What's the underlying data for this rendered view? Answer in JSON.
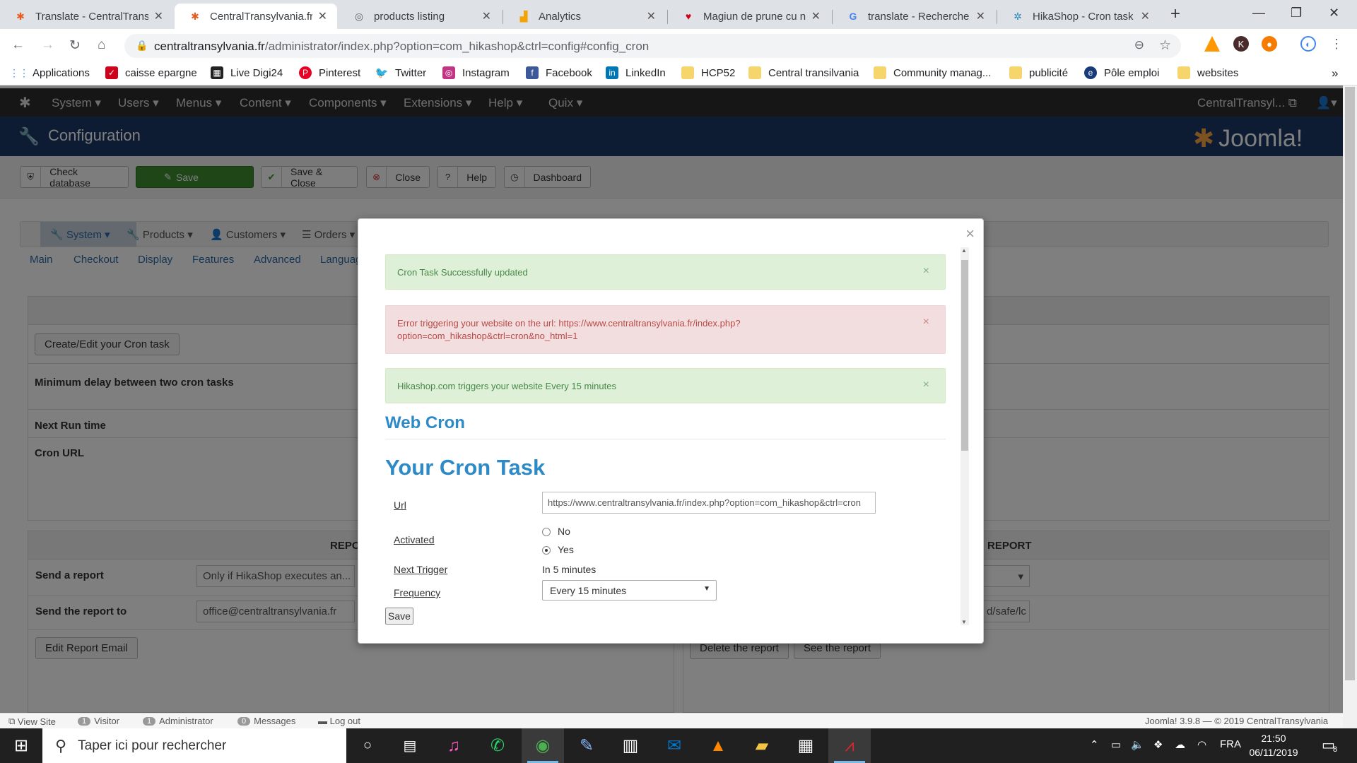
{
  "browser": {
    "tabs": [
      {
        "title": "Translate - CentralTrans",
        "icon": "joomla-favicon",
        "active": false
      },
      {
        "title": "CentralTransylvania.fr -",
        "icon": "joomla-favicon",
        "active": true
      },
      {
        "title": "products listing",
        "icon": "globe-icon",
        "active": false
      },
      {
        "title": "Analytics",
        "icon": "analytics-icon",
        "active": false
      },
      {
        "title": "Magiun de prune cu nu",
        "icon": "heart-icon",
        "active": false
      },
      {
        "title": "translate - Recherche G",
        "icon": "google-icon",
        "active": false
      },
      {
        "title": "HikaShop - Cron task",
        "icon": "hikashop-icon",
        "active": false
      }
    ],
    "new_tab": "+",
    "url_host": "centraltransylvania.fr",
    "url_path": "/administrator/index.php?option=com_hikashop&ctrl=config#config_cron",
    "bookmarks": [
      {
        "label": "Applications"
      },
      {
        "label": "caisse epargne"
      },
      {
        "label": "Live Digi24"
      },
      {
        "label": "Pinterest"
      },
      {
        "label": "Twitter"
      },
      {
        "label": "Instagram"
      },
      {
        "label": "Facebook"
      },
      {
        "label": "LinkedIn"
      },
      {
        "label": "HCP52"
      },
      {
        "label": "Central transilvania"
      },
      {
        "label": "Community manag..."
      },
      {
        "label": "publicité"
      },
      {
        "label": "Pôle emploi"
      },
      {
        "label": "websites"
      }
    ],
    "more": "»",
    "ext_k": "K"
  },
  "joomla": {
    "menu": [
      "System",
      "Users",
      "Menus",
      "Content",
      "Components",
      "Extensions",
      "Help",
      "Quix"
    ],
    "site_name": "CentralTransyl...",
    "page_title": "Configuration",
    "brand": "Joomla!",
    "toolbar": {
      "check_database": "Check database",
      "save": "Save",
      "save_close": "Save & Close",
      "close": "Close",
      "help": "Help",
      "dashboard": "Dashboard"
    },
    "hika_nav": [
      "System",
      "Products",
      "Customers",
      "Orders"
    ],
    "sub_tabs": [
      "Main",
      "Checkout",
      "Display",
      "Features",
      "Advanced",
      "Languag"
    ],
    "create_cron": "Create/Edit your Cron task",
    "min_delay": "Minimum delay between two cron tasks",
    "next_run": "Next Run time",
    "cron_url": "Cron URL",
    "report_left": "REPO",
    "report_right": "REPORT",
    "send_report": "Send a report",
    "send_report_value": "Only if HikaShop executes an...",
    "send_to": "Send the report to",
    "send_to_value": "office@centraltransylvania.fr",
    "right_field_value": "d/safe/lc",
    "edit_report": "Edit Report Email",
    "delete_report": "Delete the report",
    "see_report": "See the report",
    "status": {
      "view_site": "View Site",
      "visitor_count": "1",
      "visitor": "Visitor",
      "admin_count": "1",
      "admin": "Administrator",
      "messages_count": "0",
      "messages": "Messages",
      "logout": "Log out",
      "footer": "Joomla! 3.9.8 — © 2019 CentralTransylvania"
    }
  },
  "modal": {
    "alert_success": "Cron Task Successfully updated",
    "alert_error": "Error triggering your website on the url: https://www.centraltransylvania.fr/index.php?option=com_hikashop&ctrl=cron&no_html=1",
    "alert_info": "Hikashop.com triggers your website Every 15 minutes",
    "heading_web_cron": "Web Cron",
    "heading_task": "Your Cron Task",
    "url_label": "Url",
    "url_value": "https://www.centraltransylvania.fr/index.php?option=com_hikashop&ctrl=cron",
    "activated_label": "Activated",
    "opt_no": "No",
    "opt_yes": "Yes",
    "next_trigger_label": "Next Trigger",
    "next_trigger_value": "In 5 minutes",
    "frequency_label": "Frequency",
    "frequency_value": "Every 15 minutes",
    "save": "Save",
    "close": "×"
  },
  "taskbar": {
    "search_placeholder": "Taper ici pour rechercher",
    "lang": "FRA",
    "time": "21:50",
    "date": "06/11/2019",
    "notif_count": "8"
  },
  "colors": {
    "joomla_nav": "#2c2c2c",
    "joomla_header": "#1a3867",
    "save_green": "#3c8d2f",
    "heading_blue": "#2d8ac7"
  }
}
